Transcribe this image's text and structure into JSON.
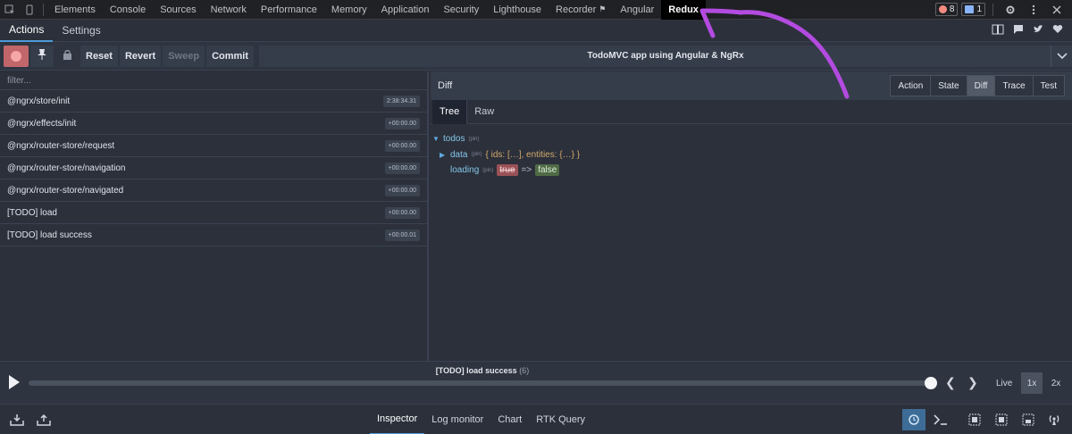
{
  "devtools": {
    "tabs": [
      "Elements",
      "Console",
      "Sources",
      "Network",
      "Performance",
      "Memory",
      "Application",
      "Security",
      "Lighthouse",
      "Recorder",
      "Angular",
      "Redux"
    ],
    "active_tab": "Redux",
    "error_count": "8",
    "message_count": "1"
  },
  "subtabs": {
    "actions": "Actions",
    "settings": "Settings"
  },
  "toolbar": {
    "reset": "Reset",
    "revert": "Revert",
    "sweep": "Sweep",
    "commit": "Commit",
    "instance": "TodoMVC app using Angular & NgRx"
  },
  "actions": {
    "filter_placeholder": "filter...",
    "items": [
      {
        "name": "@ngrx/store/init",
        "time": "2:38:34.31"
      },
      {
        "name": "@ngrx/effects/init",
        "time": "+00:00.00"
      },
      {
        "name": "@ngrx/router-store/request",
        "time": "+00:00.00"
      },
      {
        "name": "@ngrx/router-store/navigation",
        "time": "+00:00.00"
      },
      {
        "name": "@ngrx/router-store/navigated",
        "time": "+00:00.00"
      },
      {
        "name": "[TODO] load",
        "time": "+00:00.00"
      },
      {
        "name": "[TODO] load success",
        "time": "+00:00.01"
      }
    ]
  },
  "inspector": {
    "title": "Diff",
    "tabs": [
      "Action",
      "State",
      "Diff",
      "Trace",
      "Test"
    ],
    "active_tab": "Diff",
    "view_tabs": [
      "Tree",
      "Raw"
    ],
    "tree": {
      "root_key": "todos",
      "pin": "(pin)",
      "data_key": "data",
      "data_preview": "{ ids: […], entities: {…} }",
      "loading_key": "loading",
      "loading_old": "true",
      "arrow": "=>",
      "loading_new": "false"
    }
  },
  "slider": {
    "label": "[TODO] load success",
    "count": "(6)",
    "progress": 1.0,
    "live": "Live",
    "speed_1x": "1x",
    "speed_2x": "2x"
  },
  "bottom": {
    "tabs": [
      "Inspector",
      "Log monitor",
      "Chart",
      "RTK Query"
    ],
    "active_tab": "Inspector"
  },
  "colors": {
    "accent": "#4f9bd8",
    "annotation": "#b44be1"
  }
}
